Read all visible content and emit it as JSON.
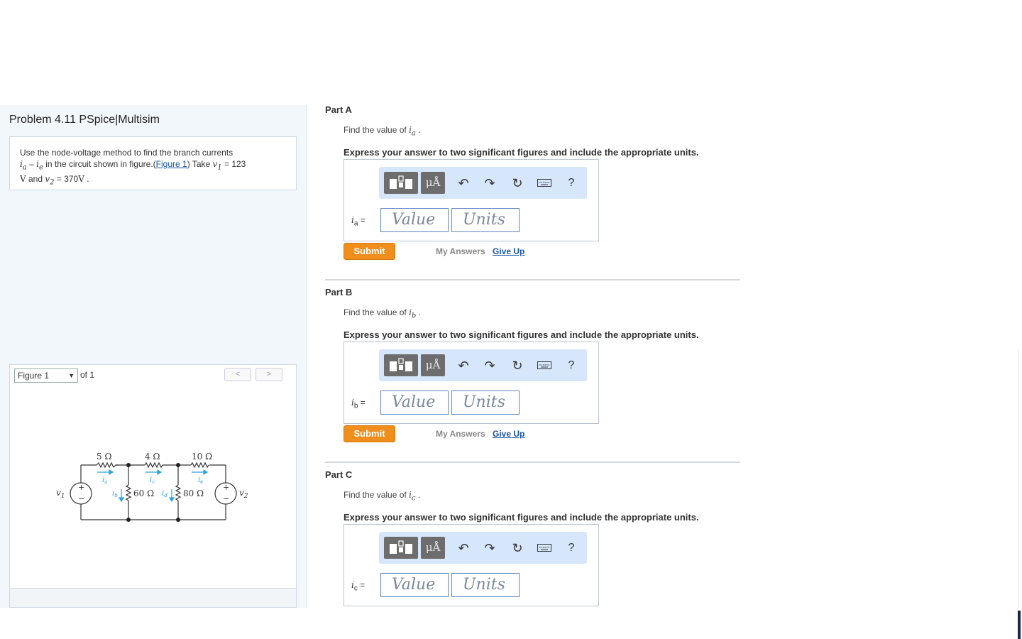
{
  "problem": {
    "title": "Problem 4.11 PSpice|Multisim",
    "text_1": "Use the node-voltage method to find the branch currents",
    "ia": "i",
    "ia_sub": "a",
    "dash": " – ",
    "ie": "i",
    "ie_sub": "e",
    "text_2": " in the circuit shown in figure.(",
    "figure_link": "Figure 1",
    "text_3": ") Take ",
    "v1": "v",
    "v1_sub": "1",
    "text_4": " = 123",
    "unit_v": "V",
    "text_5": " and ",
    "v2": "v",
    "v2_sub": "2",
    "text_6": " = 370",
    "text_7": "V",
    "text_8": " ."
  },
  "figure": {
    "selector": "Figure 1",
    "of_label": "of 1",
    "prev": "<",
    "next": ">",
    "circuit": {
      "r1": "5 Ω",
      "r2": "4 Ω",
      "r3": "10 Ω",
      "r4": "60 Ω",
      "r5": "80 Ω",
      "v1": "v",
      "v1_sub": "1",
      "v2": "v",
      "v2_sub": "2",
      "ia": "i",
      "ia_sub": "a",
      "ib": "i",
      "ib_sub": "b",
      "ic": "i",
      "ic_sub": "c",
      "id": "i",
      "id_sub": "d",
      "ie": "i",
      "ie_sub": "e",
      "plus": "+",
      "minus": "−"
    }
  },
  "toolbar": {
    "units_button": "μÅ",
    "icons": [
      "templates-icon",
      "units-icon",
      "undo-icon",
      "redo-icon",
      "reset-icon",
      "keyboard-icon",
      "help-icon"
    ],
    "help": "?"
  },
  "parts": [
    {
      "title": "Part A",
      "find_prefix": "Find the value of ",
      "var": "i",
      "var_sub": "a",
      "find_suffix": " .",
      "express": "Express your answer to two significant figures and include the appropriate units.",
      "label_var": "i",
      "label_sub": "a",
      "label_eq": " =",
      "value_placeholder": "Value",
      "units_placeholder": "Units",
      "submit": "Submit",
      "my_answers": "My Answers",
      "give_up": "Give Up"
    },
    {
      "title": "Part B",
      "find_prefix": "Find the value of ",
      "var": "i",
      "var_sub": "b",
      "find_suffix": " .",
      "express": "Express your answer to two significant figures and include the appropriate units.",
      "label_var": "i",
      "label_sub": "b",
      "label_eq": " =",
      "value_placeholder": "Value",
      "units_placeholder": "Units",
      "submit": "Submit",
      "my_answers": "My Answers",
      "give_up": "Give Up"
    },
    {
      "title": "Part C",
      "find_prefix": "Find the value of ",
      "var": "i",
      "var_sub": "c",
      "find_suffix": " .",
      "express": "Express your answer to two significant figures and include the appropriate units.",
      "label_var": "i",
      "label_sub": "c",
      "label_eq": " =",
      "value_placeholder": "Value",
      "units_placeholder": "Units"
    }
  ]
}
